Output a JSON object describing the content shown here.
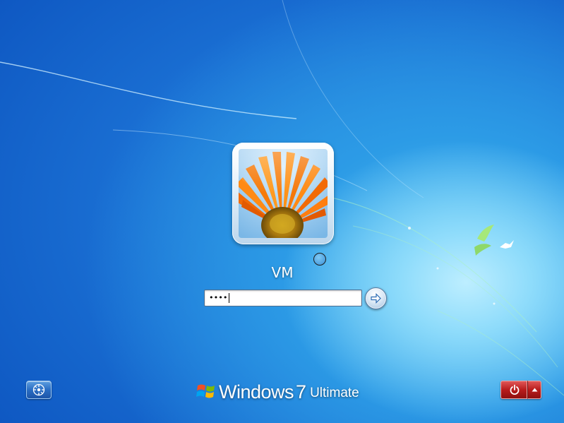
{
  "user": {
    "name": "VM",
    "avatar": "orange-gerbera-flower"
  },
  "password_field": {
    "value": "••••",
    "masked_length": 4
  },
  "brand": {
    "name": "Windows",
    "version": "7",
    "edition": "Ultimate"
  },
  "icons": {
    "ease_of_access": "ease-of-access-icon",
    "submit": "arrow-right-icon",
    "shutdown": "power-icon",
    "shutdown_options": "triangle-up-icon",
    "logo": "windows-flag-icon",
    "busy": "busy-circle-icon"
  },
  "colors": {
    "background": "#1a6fd3",
    "shutdown": "#b81c1c",
    "text": "#ffffff"
  }
}
